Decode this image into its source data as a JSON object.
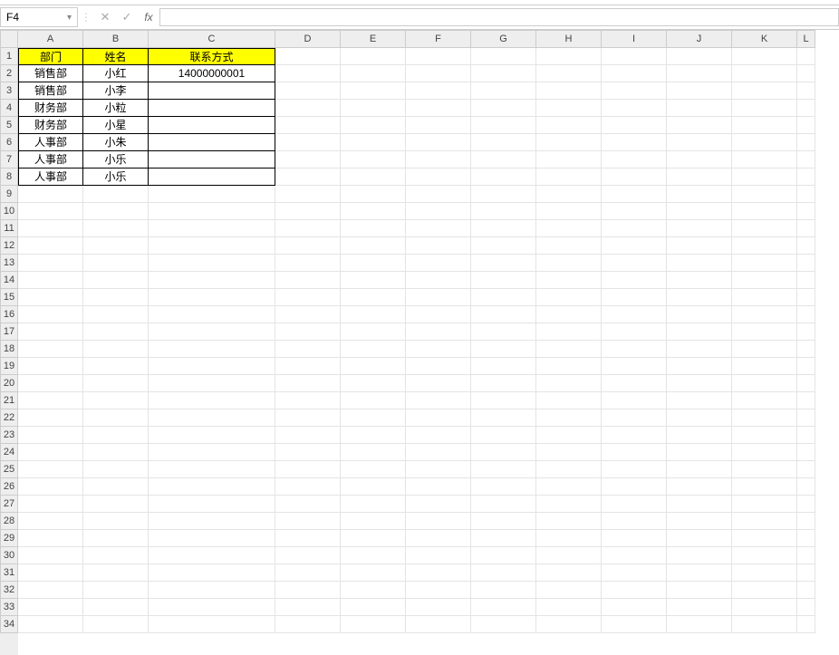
{
  "name_box": "F4",
  "formula_value": "",
  "columns": [
    "A",
    "B",
    "C",
    "D",
    "E",
    "F",
    "G",
    "H",
    "I",
    "J",
    "K",
    "L"
  ],
  "col_widths": [
    "wA",
    "wB",
    "wC",
    "wStd",
    "wStd",
    "wStd",
    "wStd",
    "wStd",
    "wStd",
    "wStd",
    "wStd",
    "wL"
  ],
  "row_count": 34,
  "headers": {
    "A": "部门",
    "B": "姓名",
    "C": "联系方式"
  },
  "data_rows": [
    {
      "A": "销售部",
      "B": "小红",
      "C": "14000000001"
    },
    {
      "A": "销售部",
      "B": "小李",
      "C": ""
    },
    {
      "A": "财务部",
      "B": "小粒",
      "C": ""
    },
    {
      "A": "财务部",
      "B": "小星",
      "C": ""
    },
    {
      "A": "人事部",
      "B": "小朱",
      "C": ""
    },
    {
      "A": "人事部",
      "B": "小乐",
      "C": ""
    },
    {
      "A": "人事部",
      "B": "小乐",
      "C": ""
    }
  ],
  "icons": {
    "cancel": "✕",
    "accept": "✓",
    "fx": "fx",
    "dropdown": "▾",
    "sep": "⋮"
  }
}
